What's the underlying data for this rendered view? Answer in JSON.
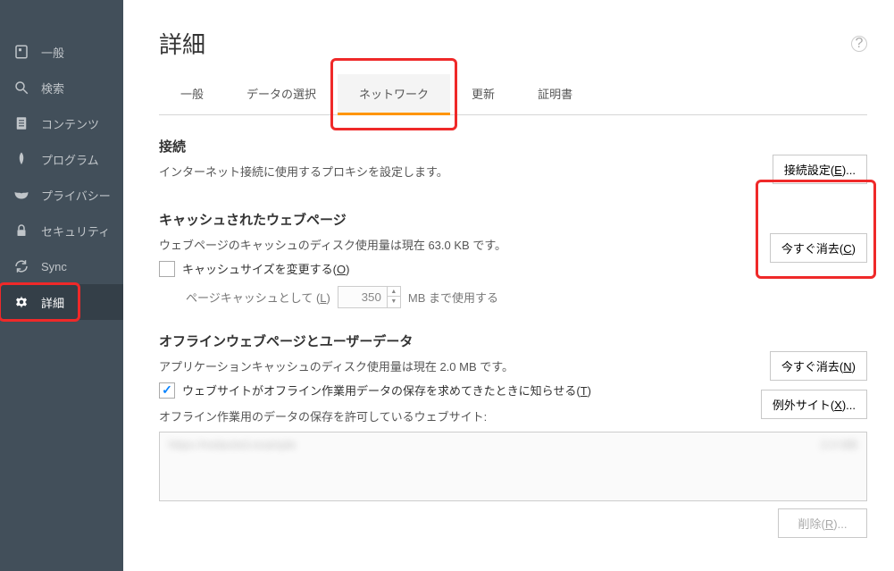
{
  "sidebar": {
    "items": [
      {
        "label": "一般"
      },
      {
        "label": "検索"
      },
      {
        "label": "コンテンツ"
      },
      {
        "label": "プログラム"
      },
      {
        "label": "プライバシー"
      },
      {
        "label": "セキュリティ"
      },
      {
        "label": "Sync"
      },
      {
        "label": "詳細"
      }
    ]
  },
  "page": {
    "title": "詳細"
  },
  "tabs": [
    {
      "label": "一般"
    },
    {
      "label": "データの選択"
    },
    {
      "label": "ネットワーク"
    },
    {
      "label": "更新"
    },
    {
      "label": "証明書"
    }
  ],
  "connection": {
    "heading": "接続",
    "desc": "インターネット接続に使用するプロキシを設定します。",
    "button": "接続設定(E)..."
  },
  "cache": {
    "heading": "キャッシュされたウェブページ",
    "desc_prefix": "ウェブページのキャッシュのディスク使用量は現在 ",
    "usage": "63.0 KB",
    "desc_suffix": " です。",
    "clear_button": "今すぐ消去(C)",
    "override_checkbox": "キャッシュサイズを変更する(O)",
    "limit_prefix": "ページキャッシュとして (L)",
    "limit_value": "350",
    "limit_suffix": "MB まで使用する"
  },
  "offline": {
    "heading": "オフラインウェブページとユーザーデータ",
    "desc_prefix": "アプリケーションキャッシュのディスク使用量は現在 ",
    "usage": "2.0 MB",
    "desc_suffix": " です。",
    "clear_button": "今すぐ消去(N)",
    "notify_checkbox": "ウェブサイトがオフライン作業用データの保存を求めてきたときに知らせる(T)",
    "exception_button": "例外サイト(X)...",
    "allowlist_label": "オフライン作業用のデータの保存を許可しているウェブサイト:",
    "list_entry": "https://redacted.example",
    "list_size": "2.0 MB",
    "remove_button": "削除(R)..."
  }
}
